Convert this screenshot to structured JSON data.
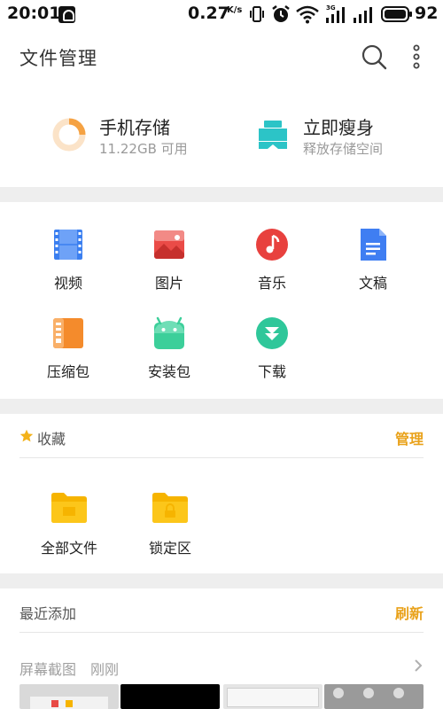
{
  "status_bar": {
    "time": "20:01",
    "net_speed": "0.27",
    "net_unit": "K/s",
    "battery": "92",
    "icons": [
      "notification-icon",
      "vibrate-icon",
      "alarm-icon",
      "wifi-icon",
      "signal-3g-icon",
      "signal-icon",
      "battery-icon"
    ]
  },
  "header": {
    "title": "文件管理",
    "icons": [
      "search-icon",
      "more-vertical-icon"
    ]
  },
  "storage": {
    "phone": {
      "title": "手机存储",
      "subtitle": "11.22GB 可用",
      "icon": "storage-ring-icon",
      "used_fraction": 0.25
    },
    "cleanup": {
      "title": "立即瘦身",
      "subtitle": "释放存储空间",
      "icon": "clean-icon"
    }
  },
  "categories": [
    {
      "label": "视频",
      "icon": "video-icon",
      "color": "#3b7ff0"
    },
    {
      "label": "图片",
      "icon": "picture-icon",
      "color": "#ea4b47"
    },
    {
      "label": "音乐",
      "icon": "music-icon",
      "color": "#e8413e"
    },
    {
      "label": "文稿",
      "icon": "document-icon",
      "color": "#3f7ef2"
    },
    {
      "label": "压缩包",
      "icon": "archive-icon",
      "color": "#f48b2c"
    },
    {
      "label": "安装包",
      "icon": "android-icon",
      "color": "#3ccf9a"
    },
    {
      "label": "下载",
      "icon": "download-icon",
      "color": "#2fc79a"
    }
  ],
  "favorites": {
    "title": "收藏",
    "action": "管理",
    "items": [
      {
        "label": "全部文件",
        "icon": "folder-icon"
      },
      {
        "label": "锁定区",
        "icon": "locked-folder-icon"
      }
    ]
  },
  "recent": {
    "title": "最近添加",
    "action": "刷新",
    "group_title": "屏幕截图",
    "group_time": "刚刚"
  },
  "colors": {
    "accent": "#e9a21b",
    "folder": "#f6b400",
    "storage_ring": "#f5a243",
    "cleanup": "#2cc4c7"
  }
}
